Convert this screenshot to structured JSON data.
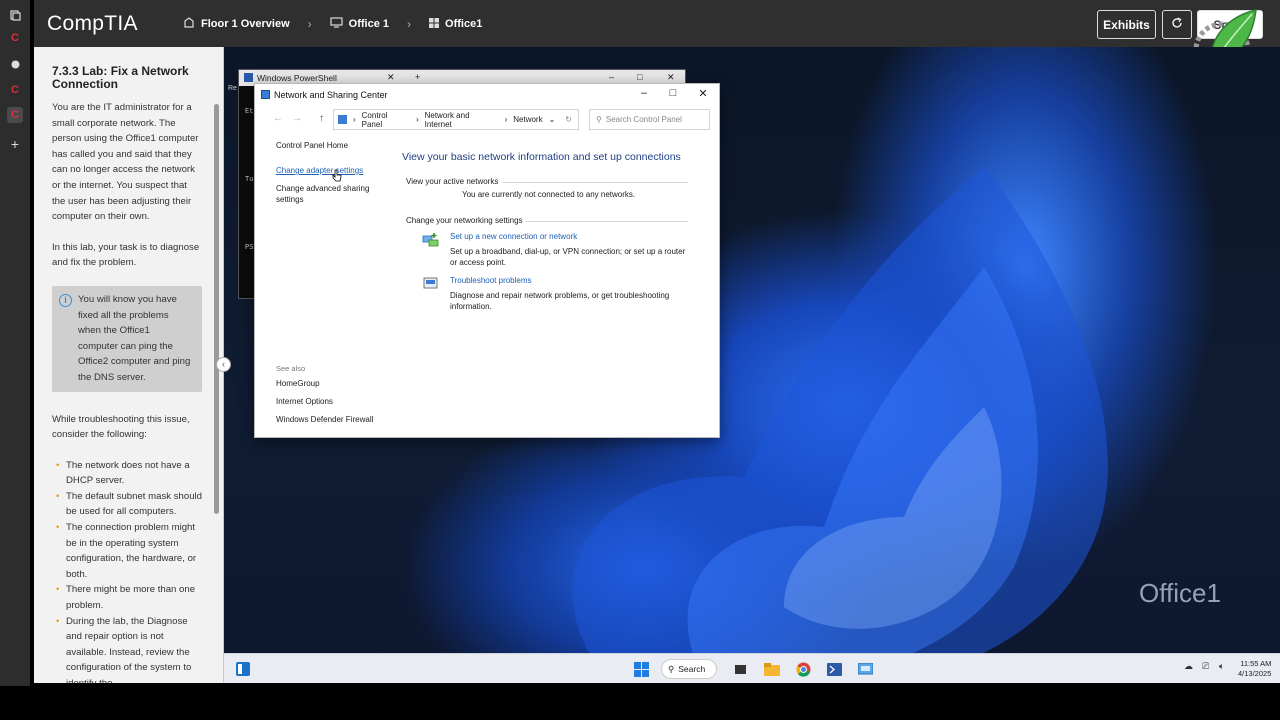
{
  "topbar": {
    "logo": "CompTIA",
    "breadcrumbs": [
      "Floor 1 Overview",
      "Office 1",
      "Office1"
    ],
    "exhibits_label": "Exhibits",
    "score_label": "Score"
  },
  "panel": {
    "title": "7.3.3 Lab: Fix a Network Connection",
    "intro": "You are the IT administrator for a small corporate network. The person using the Office1 computer has called you and said that they can no longer access the network or the internet. You suspect that the user has been adjusting their computer on their own.",
    "task": "In this lab, your task is to diagnose and fix the problem.",
    "note": "You will know you have fixed all the problems when the Office1 computer can ping the Office2 computer and ping the DNS server.",
    "consider": "While troubleshooting this issue, consider the following:",
    "bullets": [
      "The network does not have a DHCP server.",
      "The default subnet mask should be used for all computers.",
      "The connection problem might be in the operating system configuration, the hardware, or both.",
      "There might be more than one problem.",
      "During the lab, the Diagnose and repair option is not available. Instead, review the configuration of the system to identify the"
    ]
  },
  "powershell": {
    "title": "Windows PowerShell",
    "lines": [
      "Et",
      "Tu",
      "PS"
    ],
    "side_text": "Re"
  },
  "control_panel": {
    "title": "Network and Sharing Center",
    "address": [
      "Control Panel",
      "Network and Internet",
      "Network"
    ],
    "search_placeholder": "Search Control Panel",
    "left_home": "Control Panel Home",
    "left_links": [
      "Change adapter settings",
      "Change advanced sharing settings"
    ],
    "see_also_label": "See also",
    "see_also": [
      "HomeGroup",
      "Internet Options",
      "Windows Defender Firewall"
    ],
    "heading": "View your basic network information and set up connections",
    "active_networks_label": "View your active networks",
    "active_networks_status": "You are currently not connected to any networks.",
    "change_settings_label": "Change your networking settings",
    "tasks": [
      {
        "link": "Set up a new connection or network",
        "desc": "Set up a broadband, dial-up, or VPN connection; or set up a router or access point."
      },
      {
        "link": "Troubleshoot problems",
        "desc": "Diagnose and repair network problems, or get troubleshooting information."
      }
    ]
  },
  "desktop": {
    "computer_label": "Office1"
  },
  "taskbar": {
    "search_label": "Search",
    "time": "11:55 AM",
    "date": "4/13/2025"
  },
  "colors": {
    "accent_link": "#1e5fb4",
    "brand_c": "#d9303a",
    "bullet": "#e39b1a"
  }
}
